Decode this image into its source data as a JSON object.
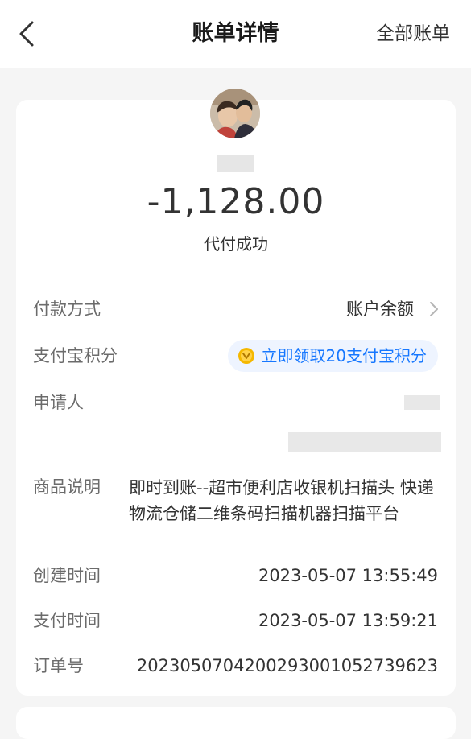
{
  "header": {
    "title": "账单详情",
    "all_bills_label": "全部账单"
  },
  "summary": {
    "amount": "-1,128.00",
    "status": "代付成功"
  },
  "rows": {
    "payment_method": {
      "label": "付款方式",
      "value": "账户余额"
    },
    "points": {
      "label": "支付宝积分",
      "value": "立即领取20支付宝积分"
    },
    "applicant": {
      "label": "申请人"
    },
    "description": {
      "label": "商品说明",
      "value": "即时到账--超市便利店收银机扫描头 快递物流仓储二维条码扫描机器扫描平台"
    },
    "created_time": {
      "label": "创建时间",
      "value": "2023-05-07 13:55:49"
    },
    "paid_time": {
      "label": "支付时间",
      "value": "2023-05-07 13:59:21"
    },
    "order_no": {
      "label": "订单号",
      "value": "2023050704200293001052739623"
    }
  },
  "colors": {
    "accent": "#1677ff",
    "pill_bg": "#eef4ff",
    "coin": "#f5b800",
    "background": "#f5f5f5"
  },
  "icons": [
    "back-icon",
    "chevron-right-icon",
    "coin-icon"
  ]
}
